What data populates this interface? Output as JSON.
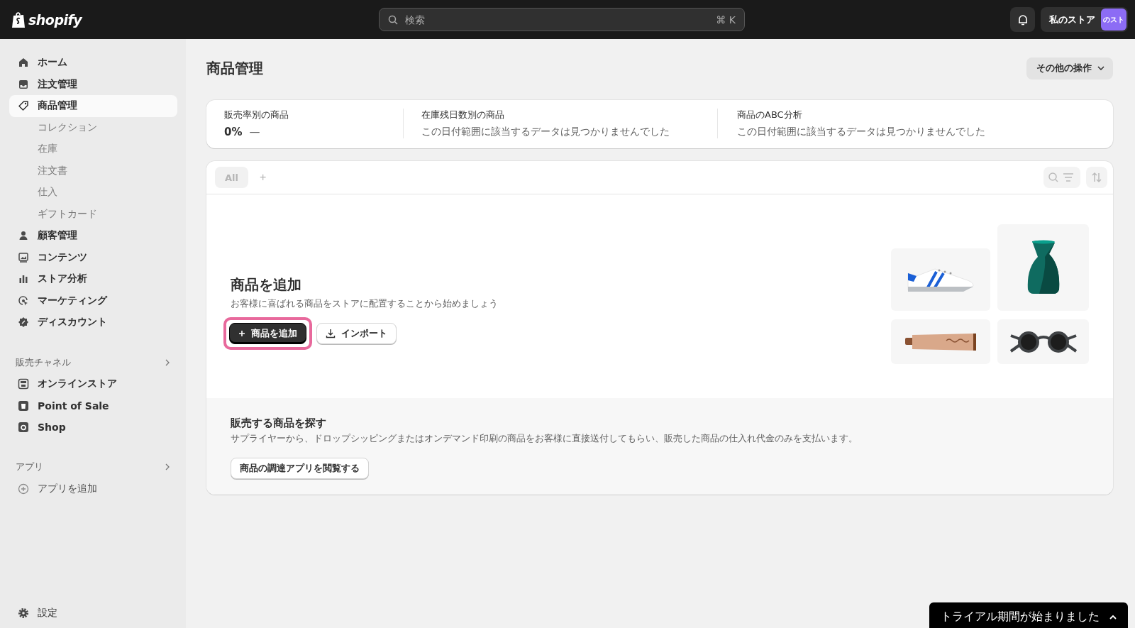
{
  "topbar": {
    "logo": "shopify",
    "search": {
      "placeholder": "検索",
      "shortcut": "⌘ K"
    },
    "store": {
      "name": "私のストア",
      "avatar": "のスト"
    }
  },
  "sidebar": {
    "items": [
      {
        "label": "ホーム",
        "selected": false
      },
      {
        "label": "注文管理",
        "selected": false
      },
      {
        "label": "商品管理",
        "selected": true,
        "children": [
          {
            "label": "コレクション"
          },
          {
            "label": "在庫"
          },
          {
            "label": "注文書"
          },
          {
            "label": "仕入"
          },
          {
            "label": "ギフトカード"
          }
        ]
      },
      {
        "label": "顧客管理",
        "selected": false
      },
      {
        "label": "コンテンツ",
        "selected": false
      },
      {
        "label": "ストア分析",
        "selected": false
      },
      {
        "label": "マーケティング",
        "selected": false
      },
      {
        "label": "ディスカウント",
        "selected": false
      }
    ],
    "sections": [
      {
        "title": "販売チャネル",
        "items": [
          {
            "label": "オンラインストア"
          },
          {
            "label": "Point of Sale"
          },
          {
            "label": "Shop"
          }
        ]
      },
      {
        "title": "アプリ",
        "items": [
          {
            "label": "アプリを追加"
          }
        ]
      }
    ],
    "settings": "設定"
  },
  "page": {
    "title": "商品管理",
    "more_actions": "その他の操作"
  },
  "metrics": [
    {
      "label": "販売率別の商品",
      "value": "0%",
      "trend": "—"
    },
    {
      "label": "在庫残日数別の商品",
      "message": "この日付範囲に該当するデータは見つかりませんでした"
    },
    {
      "label": "商品のABC分析",
      "message": "この日付範囲に該当するデータは見つかりませんでした"
    }
  ],
  "tabs": [
    {
      "label": "All",
      "selected": true
    }
  ],
  "add_tab": "+",
  "empty_state": {
    "title": "商品を追加",
    "description": "お客様に喜ばれる商品をストアに配置することから始めましょう",
    "buttons": [
      {
        "label": "商品を追加",
        "kind": "primary",
        "highlighted": true
      },
      {
        "label": "インポート",
        "kind": "import",
        "highlighted": false
      }
    ]
  },
  "find": {
    "title": "販売する商品を探す",
    "text": "サプライヤーから、ドロップシッピングまたはオンデマンド印刷の商品をお客様に直接送付してもらい、販売した商品の仕入れ代金のみを支払います。",
    "button": "商品の調達アプリを閲覧する"
  },
  "toast": {
    "text": "トライアル期間が始まりました"
  }
}
